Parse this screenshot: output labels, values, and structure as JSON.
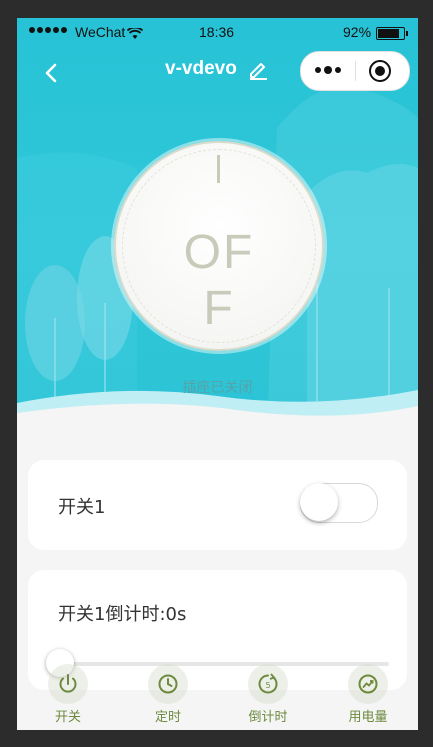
{
  "status_bar": {
    "carrier": "WeChat",
    "time": "18:36",
    "battery": "92%",
    "battery_level": 0.92
  },
  "nav": {
    "title": "v-vdevo"
  },
  "dial": {
    "state_text": "OFF"
  },
  "socket_status": "插座已关闭",
  "switch_card": {
    "label": "开关1",
    "on": false
  },
  "countdown_card": {
    "label": "开关1倒计时:0s",
    "slider_value": 0
  },
  "tabs": [
    {
      "label": "开关",
      "icon": "power-icon"
    },
    {
      "label": "定时",
      "icon": "clock-icon"
    },
    {
      "label": "倒计时",
      "icon": "countdown-icon"
    },
    {
      "label": "用电量",
      "icon": "chart-trend-icon"
    }
  ],
  "colors": {
    "hero": "#2bc2d5",
    "accent": "#6e8a3f",
    "background": "#f4f5f4"
  }
}
